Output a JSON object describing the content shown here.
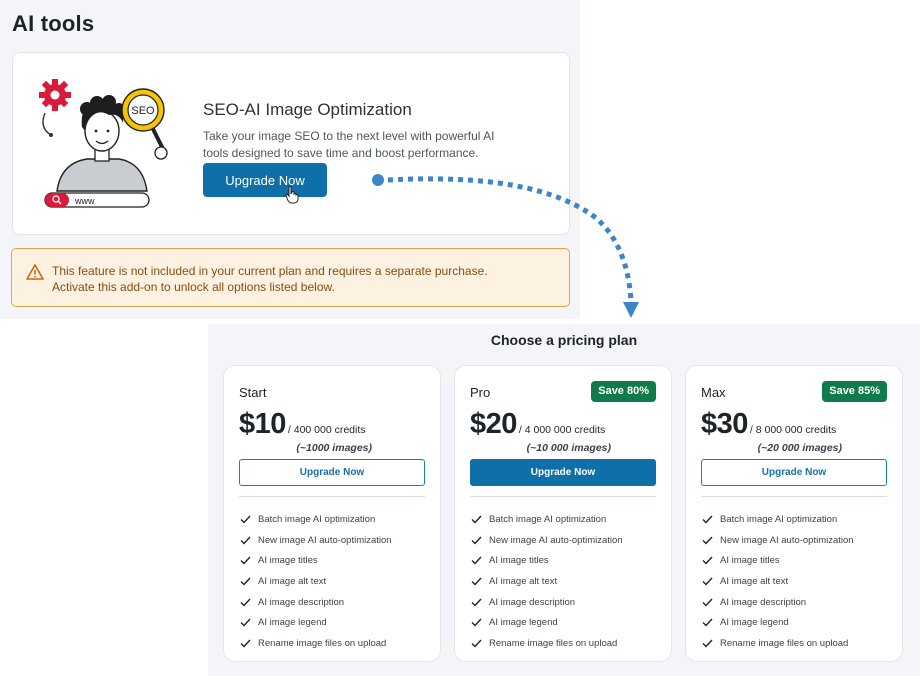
{
  "page": {
    "title": "AI tools"
  },
  "promo": {
    "title": "SEO-AI Image Optimization",
    "description": "Take your image SEO to the next level with powerful AI tools designed to save time and boost performance.",
    "upgrade_label": "Upgrade Now",
    "illustration": {
      "badge_text": "SEO",
      "searchbar_text": "www"
    }
  },
  "warning": {
    "line1": "This feature is not included in your current plan and requires a separate purchase.",
    "line2": "Activate this add-on to unlock all options listed below."
  },
  "pricing": {
    "title": "Choose a pricing plan",
    "plans": [
      {
        "name": "Start",
        "badge": "",
        "price": "$10",
        "credits": "/ 400 000 credits",
        "images": "(~1000 images)",
        "button": "Upgrade Now",
        "button_style": "outline"
      },
      {
        "name": "Pro",
        "badge": "Save 80%",
        "price": "$20",
        "credits": "/ 4 000 000 credits",
        "images": "(~10 000 images)",
        "button": "Upgrade Now",
        "button_style": "solid"
      },
      {
        "name": "Max",
        "badge": "Save 85%",
        "price": "$30",
        "credits": "/ 8 000 000 credits",
        "images": "(~20 000 images)",
        "button": "Upgrade Now",
        "button_style": "outline"
      }
    ],
    "features": [
      "Batch image AI optimization",
      "New image AI auto-optimization",
      "AI image titles",
      "AI image alt text",
      "AI image description",
      "AI image legend",
      "Rename image files on upload"
    ]
  },
  "colors": {
    "primary_button": "#0f6fa8",
    "save_badge": "#0f7b4a",
    "warning_border": "#e3a74d",
    "connector": "#3d85c6"
  }
}
